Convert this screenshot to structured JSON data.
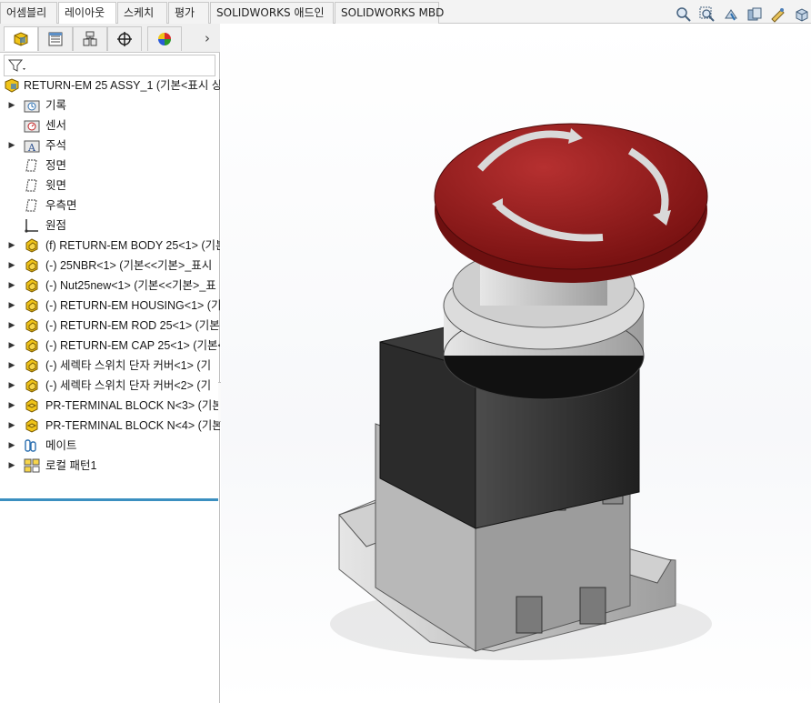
{
  "command_tabs": [
    {
      "label": "어셈블리",
      "active": false
    },
    {
      "label": "레이아웃",
      "active": true
    },
    {
      "label": "스케치",
      "active": false
    },
    {
      "label": "평가",
      "active": false
    },
    {
      "label": "SOLIDWORKS 애드인",
      "active": false
    },
    {
      "label": "SOLIDWORKS MBD",
      "active": false
    }
  ],
  "view_tools": [
    "zoom-to-fit-icon",
    "zoom-area-icon",
    "previous-view-icon",
    "section-view-icon",
    "dynamic-annotation-icon",
    "view-orientation-icon"
  ],
  "panel_tabs": [
    "feature-manager-icon",
    "property-manager-icon",
    "configuration-manager-icon",
    "dimxpert-manager-icon",
    "display-manager-icon"
  ],
  "panel_more": "›",
  "tree": {
    "root": "RETURN-EM 25 ASSY_1  (기본<표시 상",
    "items": [
      {
        "label": "기록",
        "icon": "history-folder-icon",
        "expandable": true
      },
      {
        "label": "센서",
        "icon": "sensors-folder-icon",
        "expandable": false
      },
      {
        "label": "주석",
        "icon": "annotations-folder-icon",
        "expandable": true
      },
      {
        "label": "정면",
        "icon": "plane-icon",
        "expandable": false
      },
      {
        "label": "윗면",
        "icon": "plane-icon",
        "expandable": false
      },
      {
        "label": "우측면",
        "icon": "plane-icon",
        "expandable": false
      },
      {
        "label": "원점",
        "icon": "origin-icon",
        "expandable": false
      },
      {
        "label": "(f) RETURN-EM BODY 25<1> (기본",
        "icon": "part-icon",
        "expandable": true
      },
      {
        "label": "(-) 25NBR<1> (기본<<기본>_표시",
        "icon": "part-icon",
        "expandable": true
      },
      {
        "label": "(-) Nut25new<1> (기본<<기본>_표",
        "icon": "part-icon",
        "expandable": true
      },
      {
        "label": "(-) RETURN-EM HOUSING<1> (기본",
        "icon": "part-icon",
        "expandable": true
      },
      {
        "label": "(-) RETURN-EM ROD 25<1> (기본<",
        "icon": "part-icon",
        "expandable": true
      },
      {
        "label": "(-) RETURN-EM CAP 25<1> (기본<",
        "icon": "part-icon",
        "expandable": true
      },
      {
        "label": "(-) 세렉타 스위치 단자 커버<1> (기",
        "icon": "part-icon",
        "expandable": true
      },
      {
        "label": "(-) 세렉타 스위치 단자 커버<2> (기",
        "icon": "part-icon",
        "expandable": true
      },
      {
        "label": "PR-TERMINAL BLOCK N<3> (기본<",
        "icon": "subassembly-icon",
        "expandable": true
      },
      {
        "label": "PR-TERMINAL BLOCK N<4> (기본<",
        "icon": "subassembly-icon",
        "expandable": true
      },
      {
        "label": "메이트",
        "icon": "mates-icon",
        "expandable": true
      },
      {
        "label": "로컬 패턴1",
        "icon": "local-pattern-icon",
        "expandable": true
      }
    ]
  },
  "colors": {
    "accent_divider": "#3b8fc0",
    "button_red": "#8e1a1a",
    "part_yellow": "#e8b800"
  }
}
